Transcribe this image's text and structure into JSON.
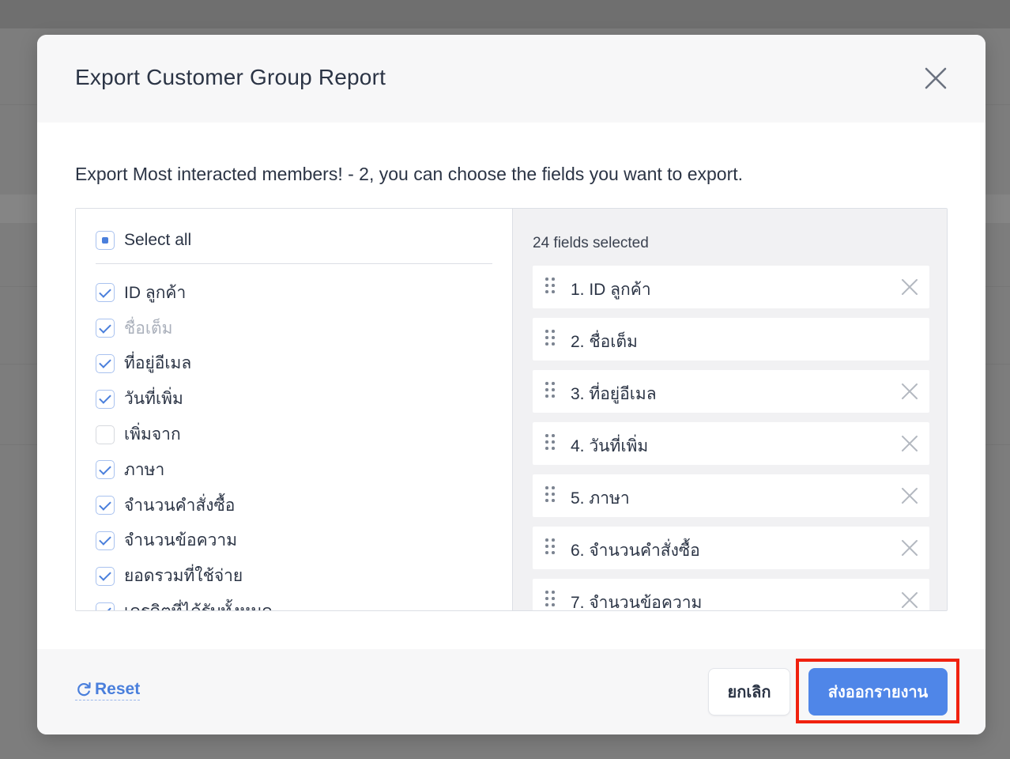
{
  "modal": {
    "title": "Export Customer Group Report",
    "description": "Export Most interacted members! - 2, you can choose the fields you want to export."
  },
  "field_picker": {
    "select_all_label": "Select all",
    "select_all_state": "indeterminate",
    "fields": [
      {
        "label": "ID ลูกค้า",
        "checked": true,
        "disabled": false
      },
      {
        "label": "ชื่อเต็ม",
        "checked": true,
        "disabled": true
      },
      {
        "label": "ที่อยู่อีเมล",
        "checked": true,
        "disabled": false
      },
      {
        "label": "วันที่เพิ่ม",
        "checked": true,
        "disabled": false
      },
      {
        "label": "เพิ่มจาก",
        "checked": false,
        "disabled": false
      },
      {
        "label": "ภาษา",
        "checked": true,
        "disabled": false
      },
      {
        "label": "จำนวนคำสั่งซื้อ",
        "checked": true,
        "disabled": false
      },
      {
        "label": "จำนวนข้อความ",
        "checked": true,
        "disabled": false
      },
      {
        "label": "ยอดรวมที่ใช้จ่าย",
        "checked": true,
        "disabled": false
      },
      {
        "label": "เครดิตที่ได้รับทั้งหมด",
        "checked": true,
        "disabled": false
      }
    ]
  },
  "selected_panel": {
    "count_label": "24 fields selected",
    "items": [
      {
        "label": "1. ID ลูกค้า",
        "removable": true
      },
      {
        "label": "2. ชื่อเต็ม",
        "removable": false
      },
      {
        "label": "3. ที่อยู่อีเมล",
        "removable": true
      },
      {
        "label": "4. วันที่เพิ่ม",
        "removable": true
      },
      {
        "label": "5. ภาษา",
        "removable": true
      },
      {
        "label": "6. จำนวนคำสั่งซื้อ",
        "removable": true
      },
      {
        "label": "7. จำนวนข้อความ",
        "removable": true
      }
    ]
  },
  "footer": {
    "reset_label": "Reset",
    "cancel_label": "ยกเลิก",
    "export_label": "ส่งออกรายงาน"
  },
  "icons": {
    "close": "close-icon",
    "drag": "drag-handle-icon",
    "remove": "remove-icon",
    "reset": "refresh-icon"
  },
  "colors": {
    "accent": "#4f86e8",
    "highlight": "#f0210f",
    "text": "#2b3445",
    "muted": "#aab0bb"
  }
}
